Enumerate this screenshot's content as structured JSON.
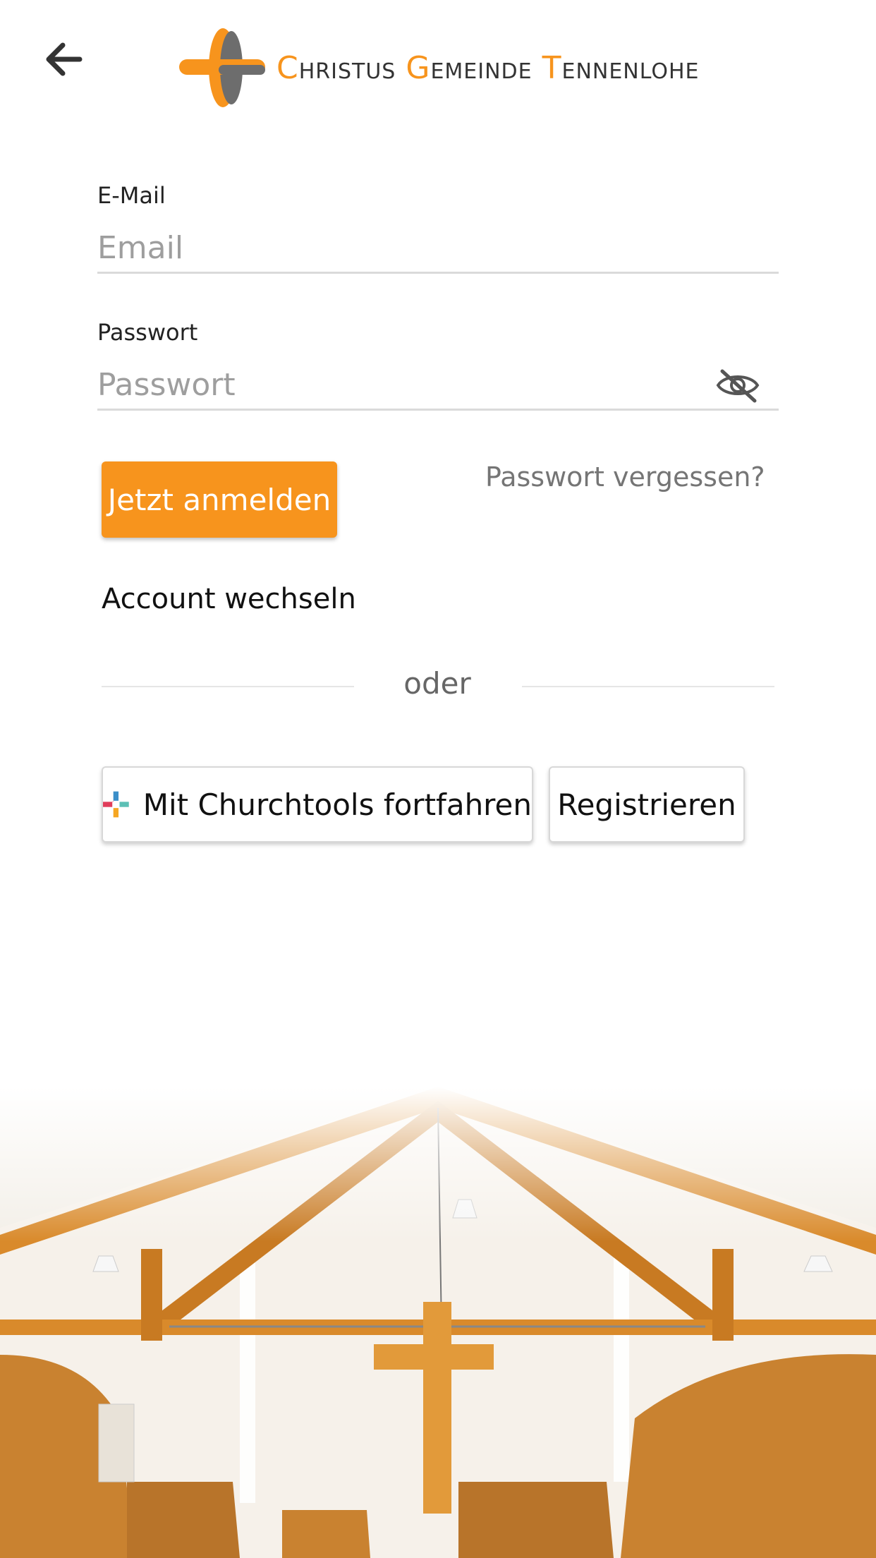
{
  "header": {
    "back_icon": "arrow-left-icon",
    "logo_words": [
      {
        "cap": "C",
        "rest": "HRISTUS"
      },
      {
        "cap": "G",
        "rest": "EMEINDE"
      },
      {
        "cap": "T",
        "rest": "ENNENLOHE"
      }
    ]
  },
  "form": {
    "email": {
      "label": "E-Mail",
      "placeholder": "Email",
      "value": ""
    },
    "password": {
      "label": "Passwort",
      "placeholder": "Passwort",
      "value": "",
      "toggle_icon": "eye-off-icon"
    },
    "login_button": "Jetzt anmelden",
    "forgot_link": "Passwort vergessen?",
    "switch_account": "Account wechseln",
    "divider_text": "oder",
    "churchtools_button": "Mit Churchtools fortfahren",
    "register_button": "Registrieren"
  },
  "colors": {
    "accent": "#f7941d",
    "wood": "#d98a2b"
  }
}
